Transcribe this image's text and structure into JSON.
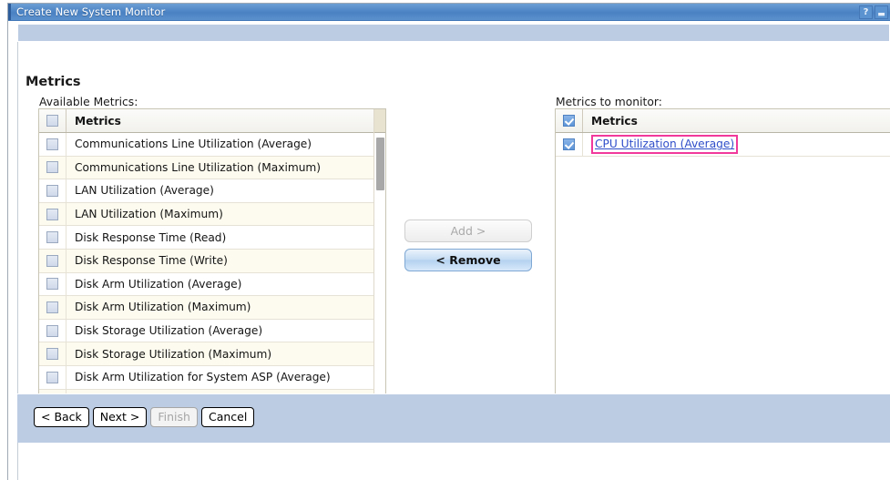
{
  "window": {
    "title": "Create New System Monitor",
    "help_icon": "question-mark-icon",
    "minimize_icon": "minimize-icon"
  },
  "page": {
    "title": "Metrics"
  },
  "available": {
    "label": "Available Metrics:",
    "header": "Metrics",
    "rows": [
      "Communications Line Utilization (Average)",
      "Communications Line Utilization (Maximum)",
      "LAN Utilization (Average)",
      "LAN Utilization (Maximum)",
      "Disk Response Time (Read)",
      "Disk Response Time (Write)",
      "Disk Arm Utilization (Average)",
      "Disk Arm Utilization (Maximum)",
      "Disk Storage Utilization (Average)",
      "Disk Storage Utilization (Maximum)",
      "Disk Arm Utilization for System ASP (Average)",
      ""
    ]
  },
  "selected": {
    "label": "Metrics to monitor:",
    "header": "Metrics",
    "rows": [
      "CPU Utilization (Average)"
    ],
    "highlight_color": "#f0399b",
    "link_color": "#2f4ec9"
  },
  "transfer": {
    "add_label": "Add  >",
    "remove_label": "<  Remove"
  },
  "footer": {
    "back_label": "< Back",
    "next_label": "Next >",
    "finish_label": "Finish",
    "cancel_label": "Cancel"
  }
}
